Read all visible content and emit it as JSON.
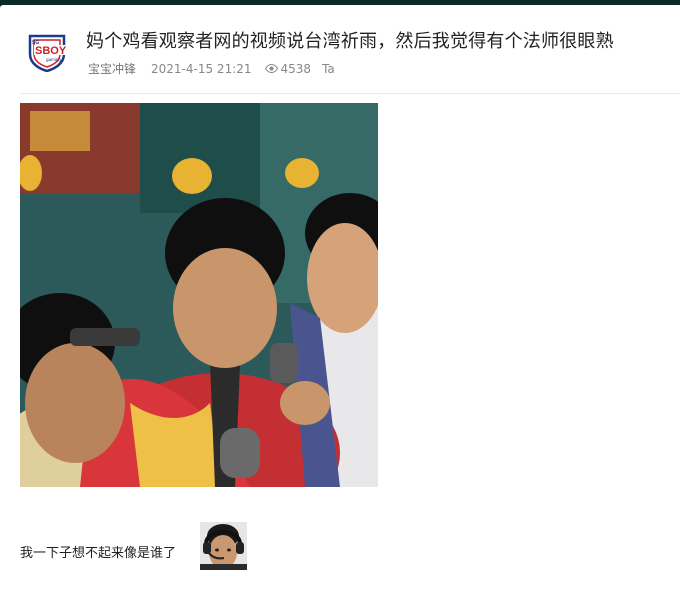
{
  "post": {
    "title": "妈个鸡看观察者网的视频说台湾祈雨，然后我觉得有个法师很眼熟",
    "author": "宝宝冲锋",
    "datetime": "2021-4-15 21:21",
    "views": "4538",
    "ta_label": "Ta",
    "caption": "我一下子想不起来像是谁了",
    "avatar_logo_text": "SBOY",
    "avatar_logo_subtext": "gaming"
  },
  "icons": {
    "views": "eye-icon"
  },
  "colors": {
    "title": "#222222",
    "meta": "#888888",
    "divider": "#e8e8e8",
    "logo_red": "#d0202a",
    "logo_blue": "#1e3a8a"
  }
}
